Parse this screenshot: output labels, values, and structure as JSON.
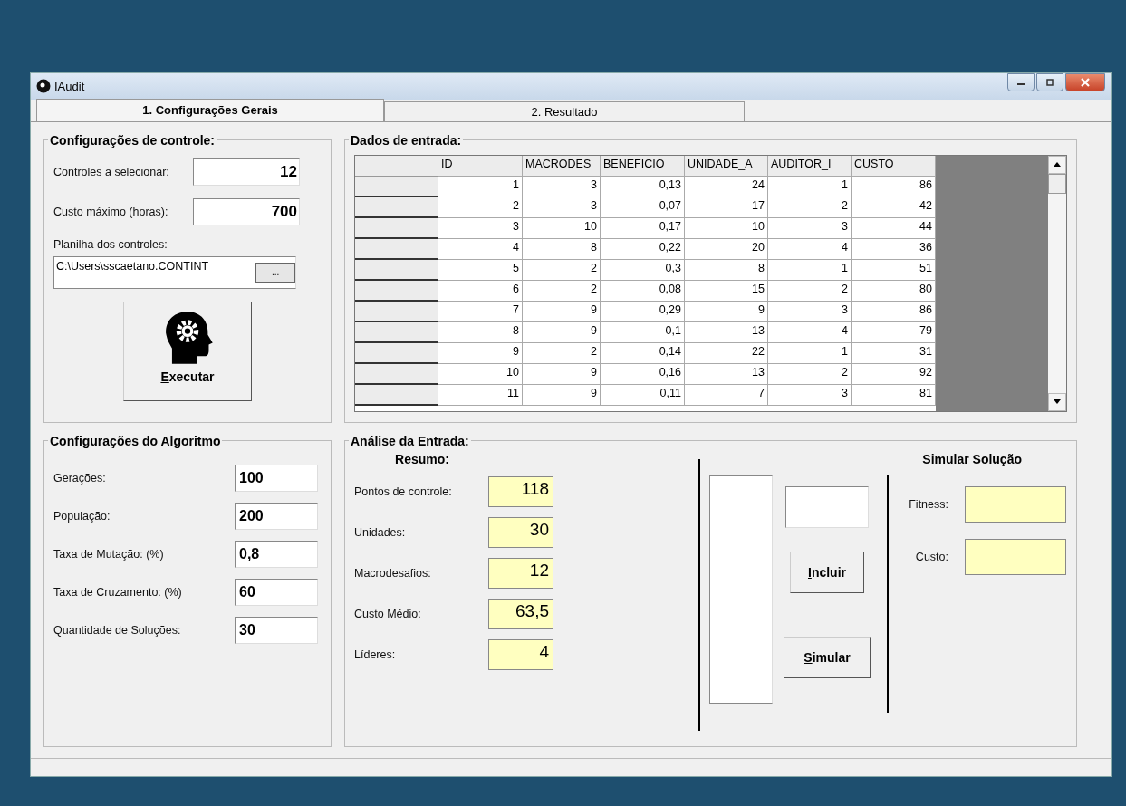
{
  "window": {
    "title": "IAudit"
  },
  "tabs": [
    {
      "label": "1. Configurações Gerais",
      "selected": true
    },
    {
      "label": "2. Resultado",
      "selected": false
    }
  ],
  "control_settings": {
    "title": "Configurações de controle:",
    "fields": [
      {
        "label": "Controles a selecionar:",
        "value": "12"
      },
      {
        "label": "Custo máximo (horas):",
        "value": "700"
      }
    ],
    "file_label": "Planilha dos controles:",
    "file_path": "C:\\Users\\sscaetano.CONTINT",
    "browse_button": "...",
    "run_button": "Executar"
  },
  "input_data": {
    "title": "Dados de entrada:",
    "columns": [
      "ID",
      "MACRODES",
      "BENEFICIO",
      "UNIDADE_A",
      "AUDITOR_I",
      "CUSTO"
    ],
    "rows": [
      [
        "1",
        "3",
        "0,13",
        "24",
        "1",
        "86"
      ],
      [
        "2",
        "3",
        "0,07",
        "17",
        "2",
        "42"
      ],
      [
        "3",
        "10",
        "0,17",
        "10",
        "3",
        "44"
      ],
      [
        "4",
        "8",
        "0,22",
        "20",
        "4",
        "36"
      ],
      [
        "5",
        "2",
        "0,3",
        "8",
        "1",
        "51"
      ],
      [
        "6",
        "2",
        "0,08",
        "15",
        "2",
        "80"
      ],
      [
        "7",
        "9",
        "0,29",
        "9",
        "3",
        "86"
      ],
      [
        "8",
        "9",
        "0,1",
        "13",
        "4",
        "79"
      ],
      [
        "9",
        "2",
        "0,14",
        "22",
        "1",
        "31"
      ],
      [
        "10",
        "9",
        "0,16",
        "13",
        "2",
        "92"
      ],
      [
        "11",
        "9",
        "0,11",
        "7",
        "3",
        "81"
      ]
    ]
  },
  "algorithm_settings": {
    "title": "Configurações do Algoritmo",
    "fields": [
      {
        "label": "Gerações:",
        "value": "100"
      },
      {
        "label": "População:",
        "value": "200"
      },
      {
        "label": "Taxa de Mutação: (%)",
        "value": "0,8"
      },
      {
        "label": "Taxa de Cruzamento: (%)",
        "value": "60"
      },
      {
        "label": "Quantidade de Soluções:",
        "value": "30"
      }
    ]
  },
  "input_analysis": {
    "title": "Análise da Entrada:",
    "summary_title": "Resumo:",
    "summary": [
      {
        "label": "Pontos de controle:",
        "value": "118"
      },
      {
        "label": "Unidades:",
        "value": "30"
      },
      {
        "label": "Macrodesafios:",
        "value": "12"
      },
      {
        "label": "Custo Médio:",
        "value": "63,5"
      },
      {
        "label": "Líderes:",
        "value": "4"
      }
    ],
    "simulate_title": "Simular Solução",
    "include_button": "Incluir",
    "simulate_button": "Simular",
    "results": [
      {
        "label": "Fitness:"
      },
      {
        "label": "Custo:"
      }
    ]
  }
}
